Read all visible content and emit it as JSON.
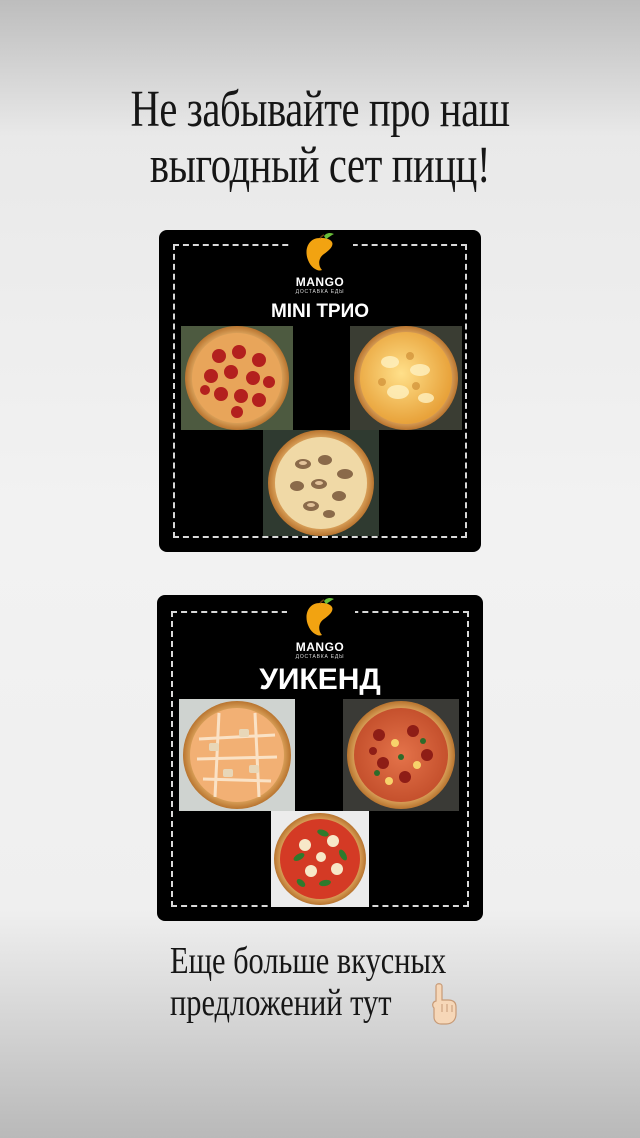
{
  "headline": {
    "line1": "Не забывайте про наш",
    "line2": "выгодный сет пицц!"
  },
  "cards": [
    {
      "brand_name": "MANGO",
      "brand_sub": "ДОСТАВКА ЕДЫ",
      "set_name": "MINI ТРИО",
      "pizzas": [
        "pepperoni",
        "four-cheese",
        "mushroom"
      ]
    },
    {
      "brand_name": "MANGO",
      "brand_sub": "ДОСТАВКА ЕДЫ",
      "set_name": "УИКЕНД",
      "pizzas": [
        "chicken",
        "hunting",
        "margherita"
      ]
    }
  ],
  "footer": {
    "line1": "Еще больше вкусных",
    "line2": "предложений тут"
  },
  "icons": {
    "pointing_hand": "pointing-down-hand-icon",
    "logo": "mango-fruit-icon"
  },
  "colors": {
    "card_bg": "#000000",
    "mango_orange": "#f2a311",
    "dash": "#d9d9d9"
  }
}
